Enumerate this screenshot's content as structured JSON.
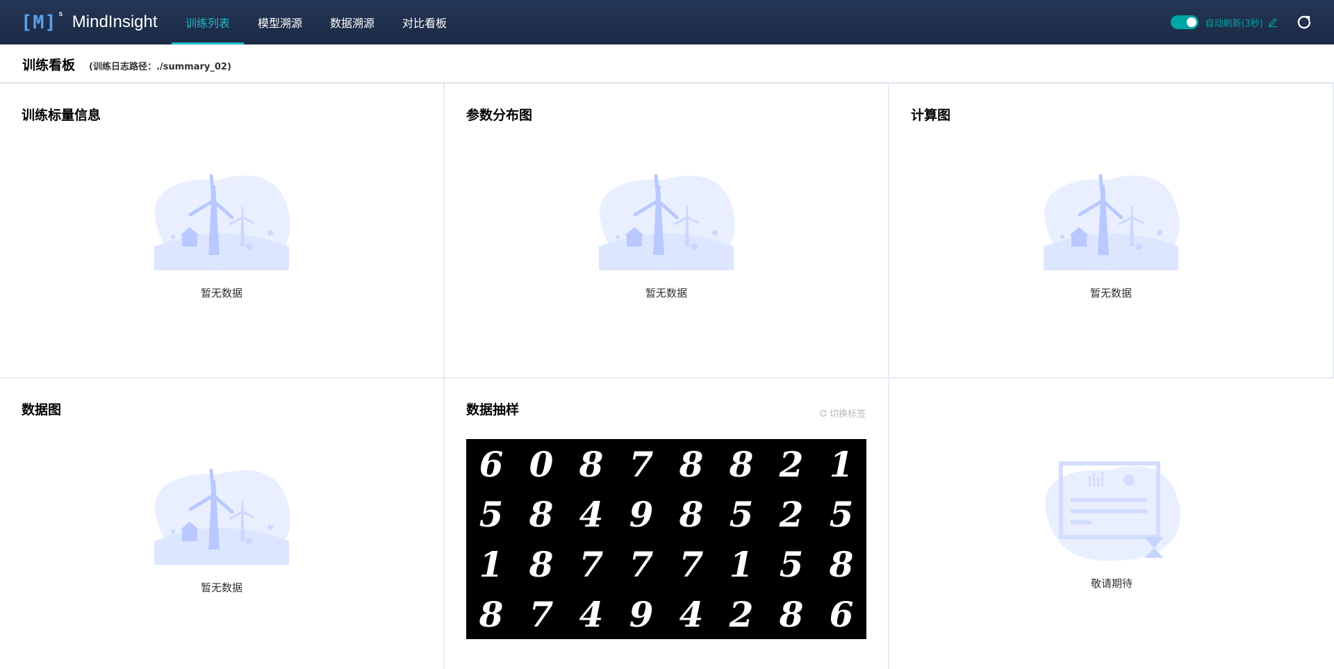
{
  "app": {
    "name": "MindInsight",
    "logo_mark": "[M]",
    "logo_sup": "s"
  },
  "nav": [
    {
      "label": "训练列表",
      "active": true
    },
    {
      "label": "模型溯源",
      "active": false
    },
    {
      "label": "数据溯源",
      "active": false
    },
    {
      "label": "对比看板",
      "active": false
    }
  ],
  "toolbar": {
    "auto_refresh_label": "自动刷新(3秒)",
    "auto_refresh_on": true
  },
  "page": {
    "title": "训练看板",
    "path": "(训练日志路径：./summary_02)"
  },
  "cards": {
    "scalar": {
      "title": "训练标量信息",
      "empty_text": "暂无数据"
    },
    "histogram": {
      "title": "参数分布图",
      "empty_text": "暂无数据"
    },
    "graph": {
      "title": "计算图",
      "empty_text": "暂无数据"
    },
    "data_graph": {
      "title": "数据图",
      "empty_text": "暂无数据"
    },
    "image": {
      "title": "数据抽样",
      "switch_label": "切换标签",
      "digits": [
        "6",
        "0",
        "8",
        "7",
        "8",
        "8",
        "2",
        "1",
        "5",
        "8",
        "4",
        "9",
        "8",
        "5",
        "2",
        "5",
        "1",
        "8",
        "7",
        "7",
        "7",
        "1",
        "5",
        "8",
        "8",
        "7",
        "4",
        "9",
        "4",
        "2",
        "8",
        "6"
      ]
    },
    "coming": {
      "text": "敬请期待"
    }
  },
  "colors": {
    "accent": "#00a5a7",
    "nav_bg": "#1b2a44",
    "illustration": "#e9efff",
    "illustration_dark": "#b9c9ff"
  }
}
